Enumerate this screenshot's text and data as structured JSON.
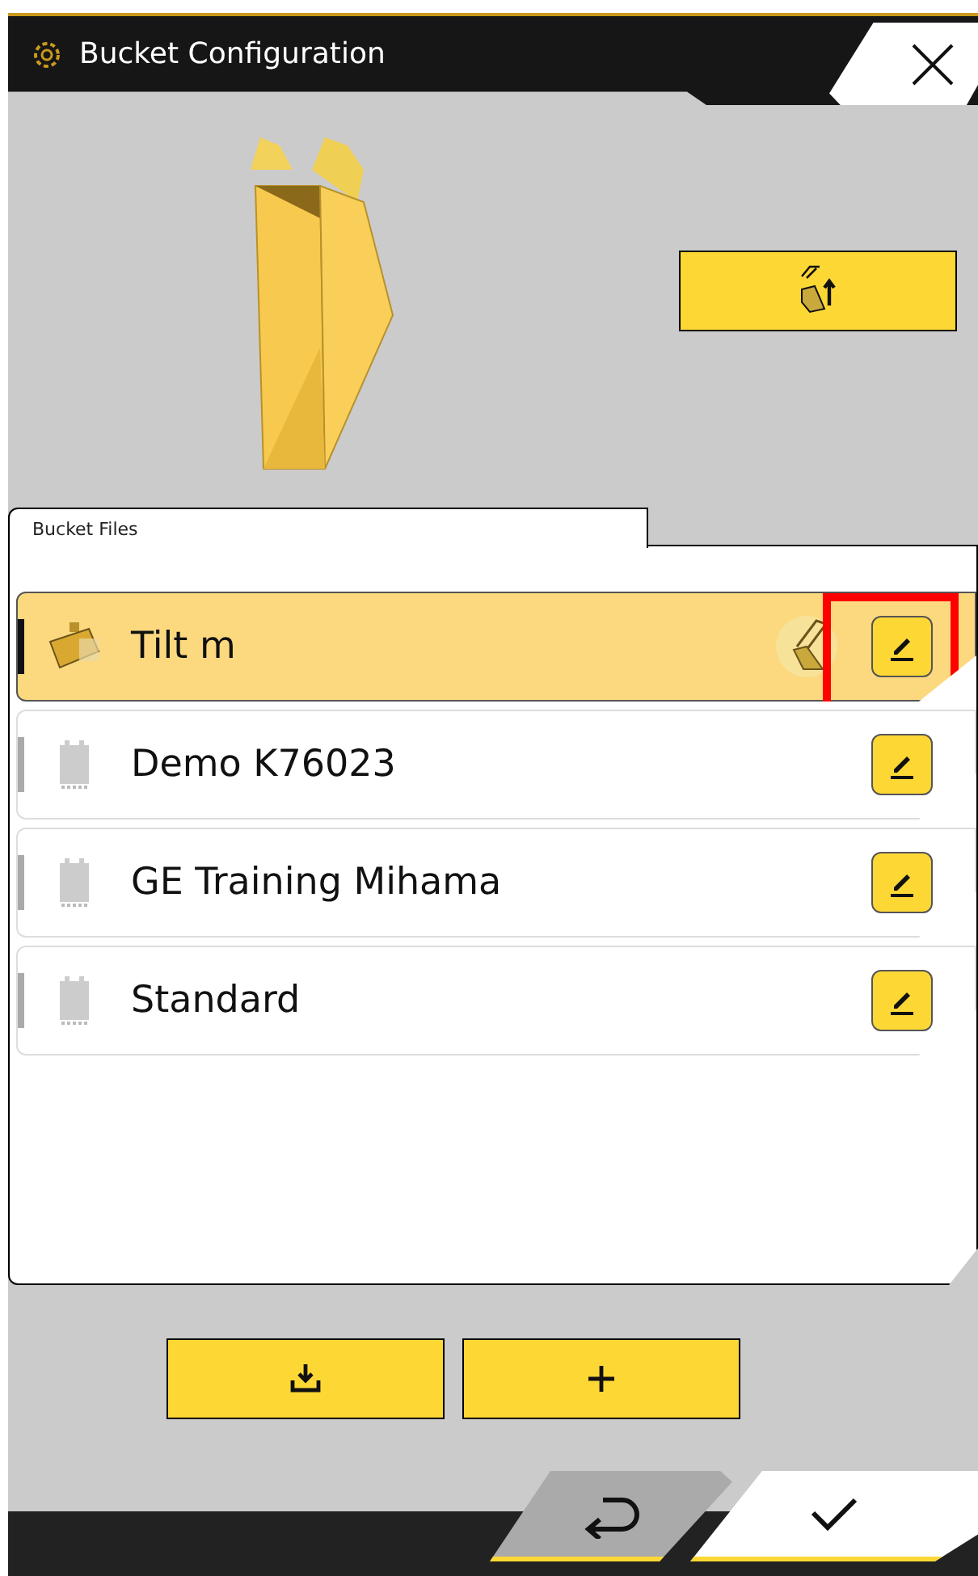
{
  "window": {
    "title": "Bucket Configuration"
  },
  "bucket_files": {
    "label": "Bucket Files",
    "items": [
      {
        "name": "Tilt m",
        "kind": "tilt",
        "selected": true,
        "attached": true,
        "highlighted": true
      },
      {
        "name": "Demo K76023",
        "kind": "standard",
        "selected": false,
        "attached": false,
        "highlighted": false
      },
      {
        "name": "GE Training Mihama",
        "kind": "standard",
        "selected": false,
        "attached": false,
        "highlighted": false
      },
      {
        "name": "Standard",
        "kind": "standard",
        "selected": false,
        "attached": false,
        "highlighted": false
      }
    ]
  }
}
